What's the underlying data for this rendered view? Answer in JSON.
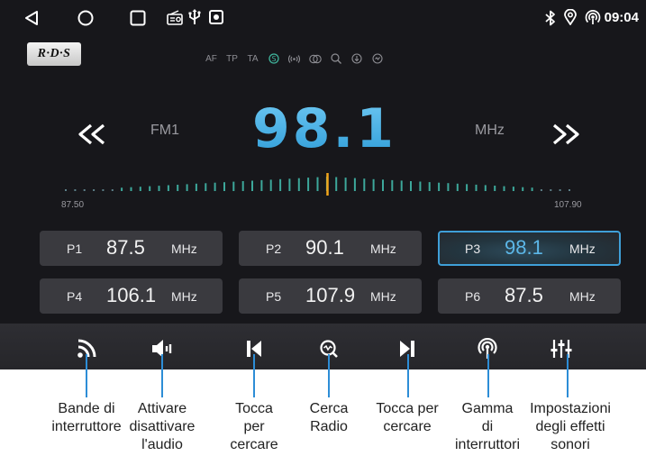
{
  "status_bar": {
    "time": "09:04",
    "left_icons": [
      "back-triangle-icon",
      "home-circle-icon",
      "recents-square-icon",
      "radio-icon",
      "usb-icon",
      "media-icon"
    ],
    "right_icons": [
      "bluetooth-icon",
      "location-icon",
      "hotspot-icon"
    ]
  },
  "rds": {
    "badge": "R·D·S",
    "items": [
      {
        "label": "AF",
        "type": "text"
      },
      {
        "label": "TP",
        "type": "text"
      },
      {
        "label": "TA",
        "type": "text"
      },
      {
        "label": "",
        "type": "stereo-icon",
        "active": true
      },
      {
        "label": "",
        "type": "broadcast-icon"
      },
      {
        "label": "",
        "type": "loudness-icon"
      },
      {
        "label": "",
        "type": "search-icon"
      },
      {
        "label": "",
        "type": "download-icon"
      },
      {
        "label": "",
        "type": "scan-icon"
      }
    ]
  },
  "tuner": {
    "band": "FM1",
    "frequency": "98.1",
    "unit": "MHz",
    "scale_min": "87.50",
    "scale_max": "107.90",
    "current_value": 98.1,
    "min_value": 87.5,
    "max_value": 107.9
  },
  "presets": [
    {
      "num": "P1",
      "freq": "87.5",
      "unit": "MHz",
      "active": false
    },
    {
      "num": "P2",
      "freq": "90.1",
      "unit": "MHz",
      "active": false
    },
    {
      "num": "P3",
      "freq": "98.1",
      "unit": "MHz",
      "active": true
    },
    {
      "num": "P4",
      "freq": "106.1",
      "unit": "MHz",
      "active": false
    },
    {
      "num": "P5",
      "freq": "107.9",
      "unit": "MHz",
      "active": false
    },
    {
      "num": "P6",
      "freq": "87.5",
      "unit": "MHz",
      "active": false
    }
  ],
  "bottom_bar": {
    "buttons": [
      "band-switch-icon",
      "mute-icon",
      "seek-previous-icon",
      "search-radio-icon",
      "seek-next-icon",
      "range-switch-icon",
      "equalizer-icon"
    ]
  },
  "captions": [
    [
      "Bande di",
      "interruttore"
    ],
    [
      "Attivare",
      "disattivare",
      "l'audio"
    ],
    [
      "Tocca",
      "per",
      "cercare"
    ],
    [
      "Cerca",
      "Radio"
    ],
    [
      "Tocca per",
      "cercare"
    ],
    [
      "Gamma",
      "di",
      "interruttori"
    ],
    [
      "Impostazioni",
      "degli effetti",
      "sonori"
    ]
  ],
  "colors": {
    "accent": "#3f9fd8",
    "frequency": "#4aaee4",
    "active_tick": "#f2a51a",
    "callout": "#2d8dd6"
  }
}
